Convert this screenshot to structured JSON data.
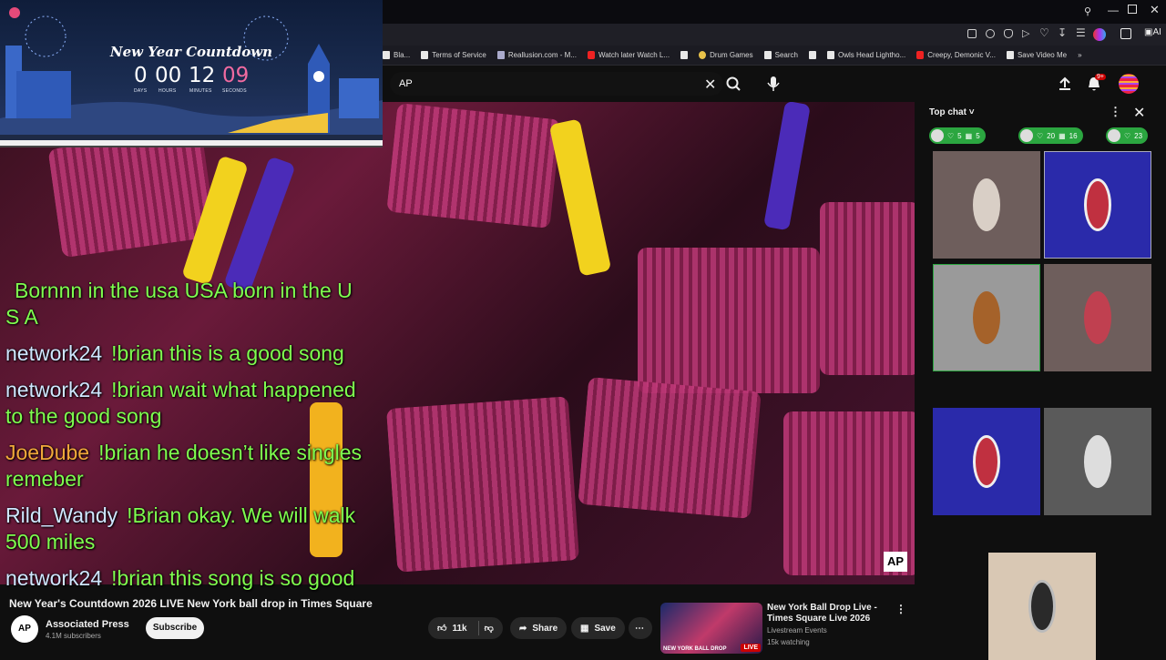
{
  "bookmarks": [
    "Bla...",
    "Terms of Service",
    "Reallusion.com - M...",
    "Watch later Watch L...",
    "Drum Games",
    "Search",
    "Owls Head Lightho...",
    "Creepy, Demonic V...",
    "Save Video Me"
  ],
  "search": {
    "value": "AP"
  },
  "countdown": {
    "title": "New Year Countdown",
    "days": "0",
    "hours": "00",
    "minutes": "12",
    "seconds": "09",
    "labels": {
      "days": "DAYS",
      "hours": "HOURS",
      "minutes": "MINUTES",
      "seconds": "SECONDS"
    }
  },
  "chat": [
    {
      "user": "",
      "text": "Bornnn in the usa USA born in the U S A"
    },
    {
      "user": "network24",
      "text": "!brian this is a good song"
    },
    {
      "user": "network24",
      "text": "!brian wait what happened to the good song"
    },
    {
      "user": "JoeDube",
      "text": "!brian he doesn’t like singles remeber"
    },
    {
      "user": "Rild_Wandy",
      "text": "!Brian okay. We will walk 500 miles"
    },
    {
      "user": "network24",
      "text": "!brian this song is so good"
    }
  ],
  "video": {
    "title": "New Year's Countdown 2026 LIVE New York ball drop in Times Square",
    "channel": "Associated Press",
    "subscribers": "4.1M subscribers",
    "subscribe_label": "Subscribe",
    "likes": "11k",
    "share_label": "Share",
    "save_label": "Save",
    "watermark": "AP"
  },
  "recommended": {
    "title": "New York Ball Drop Live - Times Square Live 2026",
    "channel": "Livestream Events",
    "meta": "15k watching",
    "badge": "LIVE",
    "thumb_text": "NEW YORK BALL DROP"
  },
  "panel": {
    "header": "Top chat",
    "gifts": [
      {
        "a": "5",
        "b": "5"
      },
      {
        "a": "20",
        "b": "16"
      },
      {
        "a": "23",
        "b": ""
      }
    ]
  },
  "colors": {
    "chat_text": "#7fff4f",
    "accent": "#ff0033"
  }
}
